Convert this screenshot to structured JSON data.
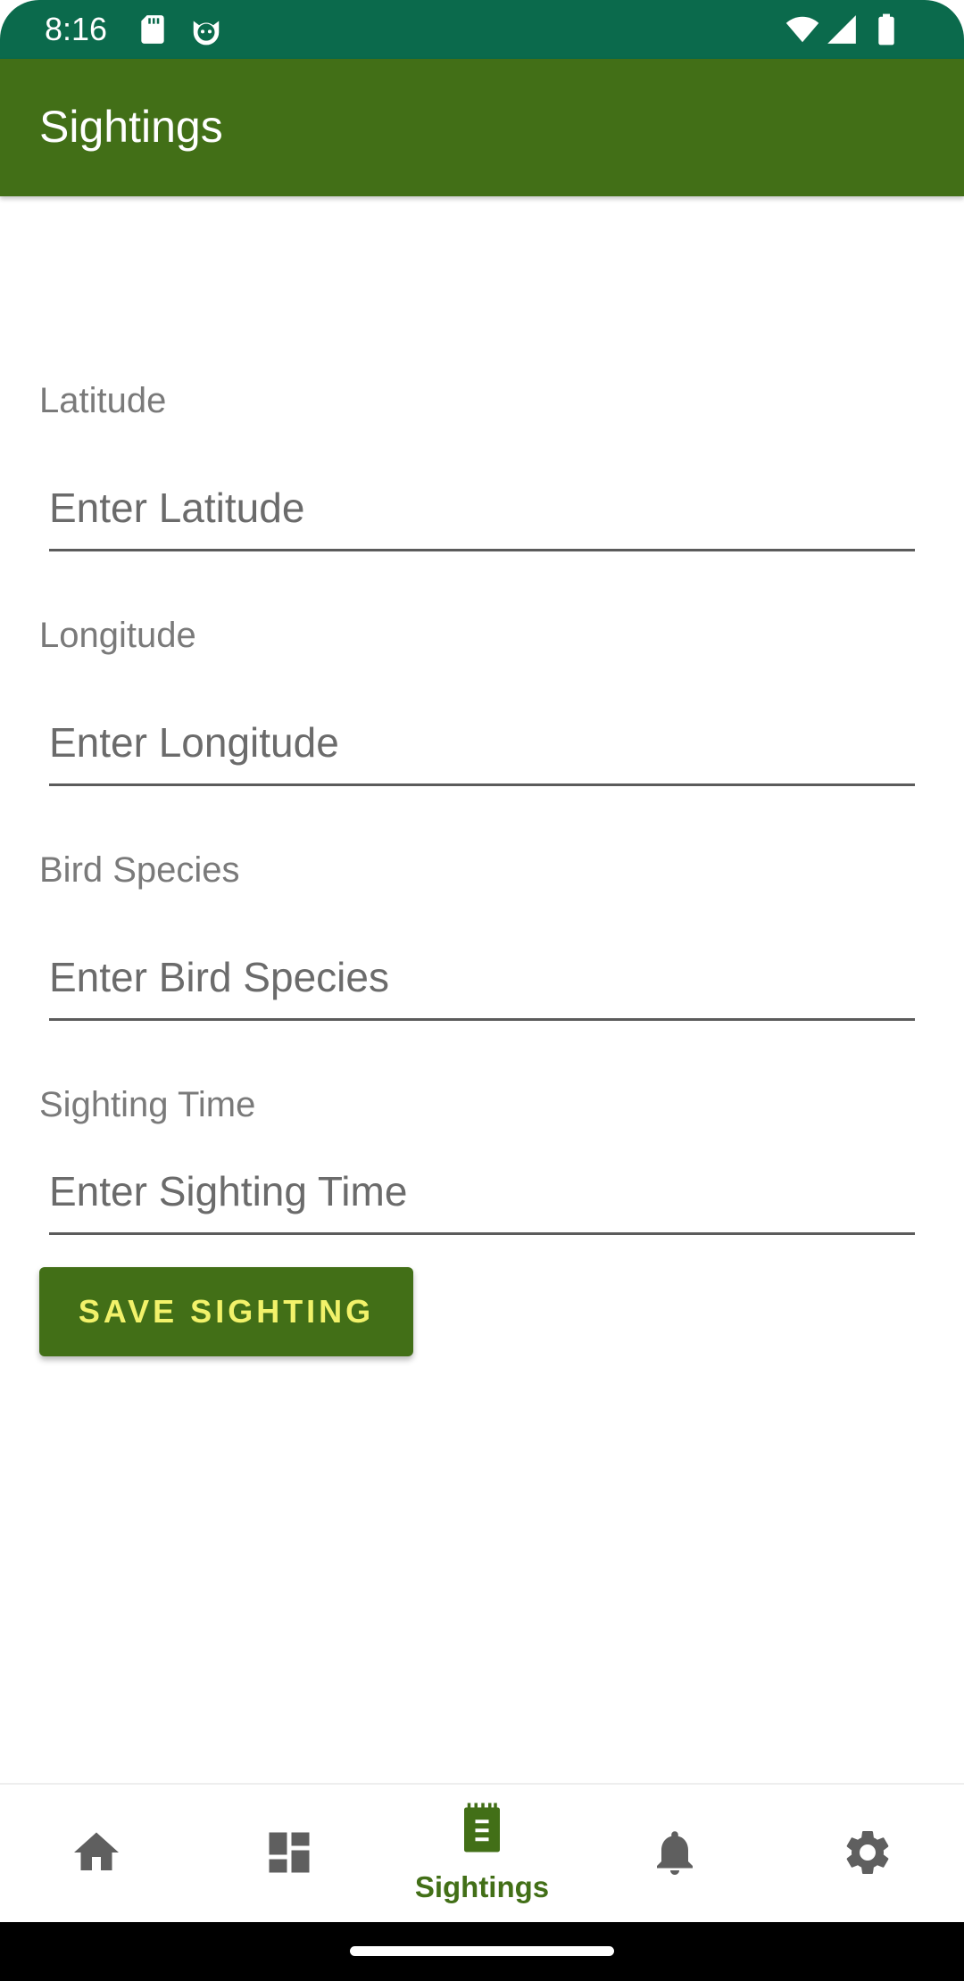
{
  "status_bar": {
    "time": "8:16",
    "left_icons": [
      "sd-card-icon",
      "cat-face-icon"
    ],
    "right_icons": [
      "wifi-icon",
      "cellular-signal-icon",
      "battery-icon"
    ]
  },
  "app_bar": {
    "title": "Sightings"
  },
  "form": {
    "latitude": {
      "label": "Latitude",
      "placeholder": "Enter Latitude",
      "value": ""
    },
    "longitude": {
      "label": "Longitude",
      "placeholder": "Enter Longitude",
      "value": ""
    },
    "species": {
      "label": "Bird Species",
      "placeholder": "Enter Bird Species",
      "value": ""
    },
    "time": {
      "label": "Sighting Time",
      "placeholder": "Enter Sighting Time",
      "value": ""
    },
    "save_label": "SAVE SIGHTING"
  },
  "bottom_nav": {
    "items": [
      {
        "icon": "home-icon",
        "label": "",
        "selected": false
      },
      {
        "icon": "dashboard-icon",
        "label": "",
        "selected": false
      },
      {
        "icon": "notepad-icon",
        "label": "Sightings",
        "selected": true
      },
      {
        "icon": "bell-icon",
        "label": "",
        "selected": false
      },
      {
        "icon": "gear-icon",
        "label": "",
        "selected": false
      }
    ]
  },
  "colors": {
    "primary": "#426f17",
    "status_bar": "#0b6a4c",
    "button_text": "#f2f26a",
    "nav_inactive": "#5f5f5f"
  }
}
